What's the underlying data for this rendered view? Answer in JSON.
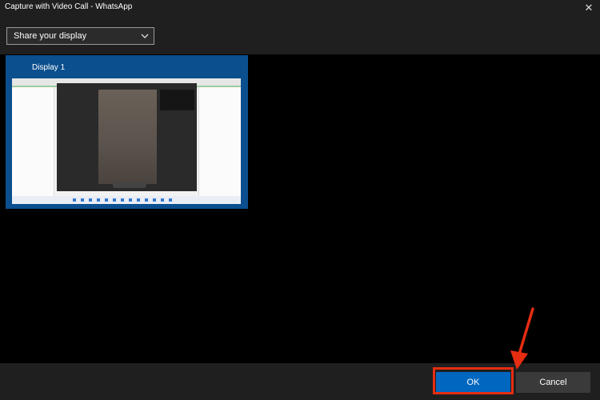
{
  "window": {
    "title": "Capture with Video Call - WhatsApp",
    "close_glyph": "✕"
  },
  "source_select": {
    "selected": "Share your display",
    "icon": "chevron-down-icon"
  },
  "displays": [
    {
      "label": "Display 1",
      "selected": true
    }
  ],
  "footer": {
    "ok_label": "OK",
    "cancel_label": "Cancel"
  },
  "annotation": {
    "highlight_color": "#e62d12",
    "target": "ok-button"
  },
  "colors": {
    "chrome": "#1f1f1f",
    "content": "#000000",
    "tile_selected": "#0b4f8e",
    "ok_button": "#0067c0",
    "cancel_button": "#3a3a3a"
  }
}
